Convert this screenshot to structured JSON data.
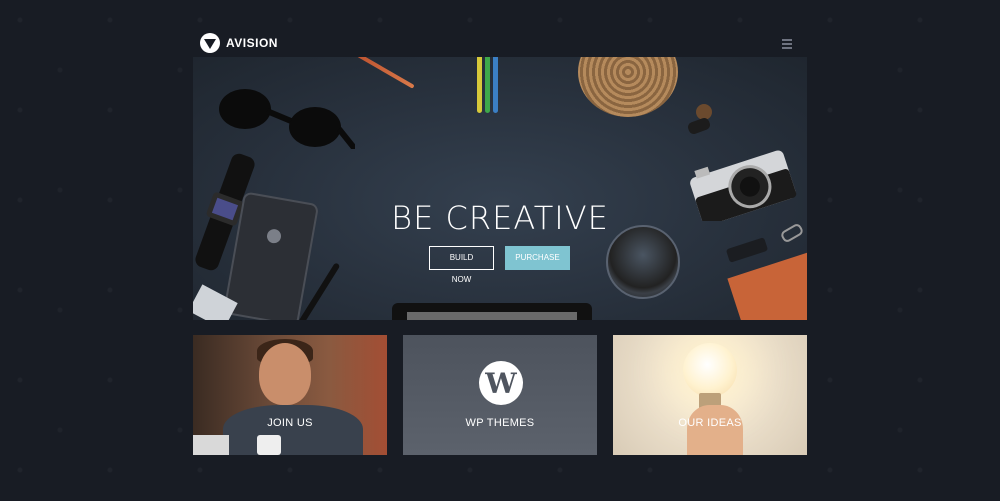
{
  "brand": {
    "name": "AVISION"
  },
  "hero": {
    "title": "BE CREATIVE",
    "buttons": {
      "build_now": "BUILD NOW",
      "purchase": "PURCHASE"
    }
  },
  "tiles": [
    {
      "label": "JOIN US"
    },
    {
      "label": "WP THEMES"
    },
    {
      "label": "OUR IDEAS"
    }
  ],
  "colors": {
    "page_bg": "#181c24",
    "accent": "#7fc4d1",
    "hero_bg": "#28313d"
  },
  "icons": {
    "logo": "avision-logo-icon",
    "menu": "hamburger-menu-icon",
    "wordpress": "wordpress-icon"
  }
}
